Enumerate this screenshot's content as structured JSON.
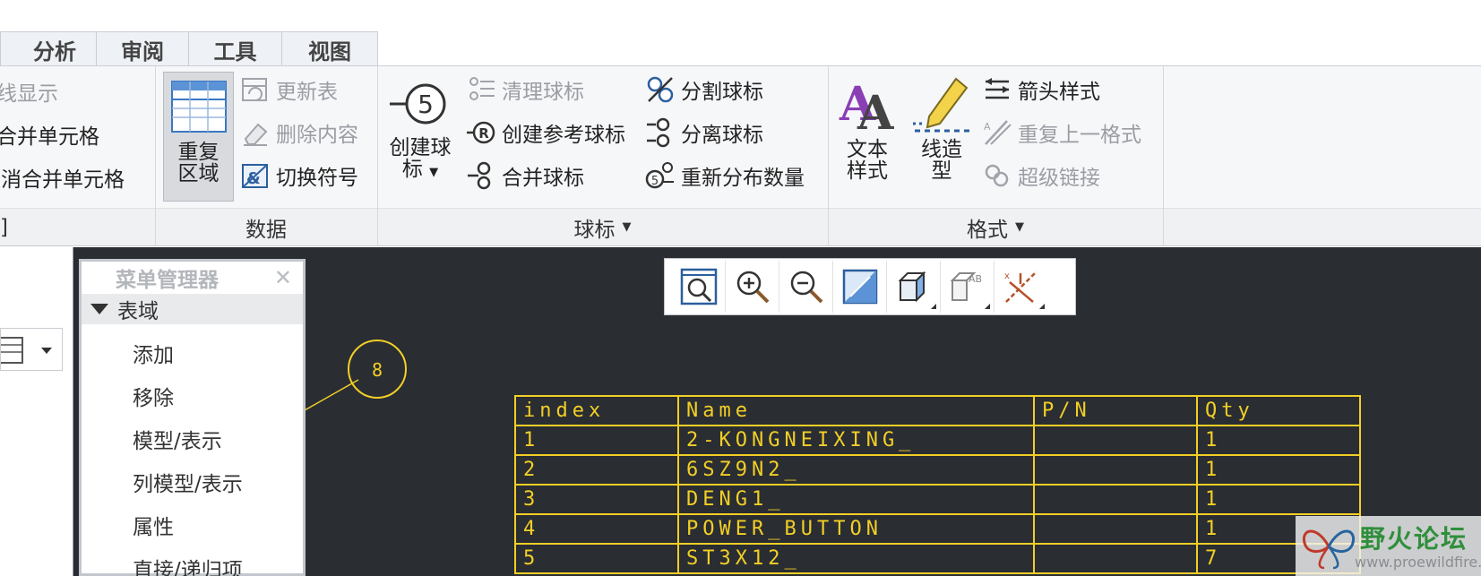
{
  "tabs": [
    "分析",
    "审阅",
    "工具",
    "视图"
  ],
  "ribbon": {
    "col1": [
      "线显示",
      "合并单元格",
      "取消合并单元格"
    ],
    "data_group": {
      "label": "数据",
      "repeat_region": {
        "line1": "重复",
        "line2": "区域"
      },
      "items": [
        "更新表",
        "删除内容",
        "切换符号"
      ]
    },
    "balloon_group": {
      "label": "球标",
      "create": {
        "line1": "创建球",
        "line2": "标"
      },
      "create_icon_text": "5",
      "items_a": [
        "清理球标",
        "创建参考球标",
        "合并球标"
      ],
      "items_b": [
        "分割球标",
        "分离球标",
        "重新分布数量"
      ]
    },
    "format_group": {
      "label": "格式",
      "text_style": {
        "line1": "文本",
        "line2": "样式"
      },
      "line_style": {
        "line1": "线造",
        "line2": "型"
      },
      "items": [
        "箭头样式",
        "重复上一格式",
        "超级链接"
      ]
    },
    "left_partial_label": "]"
  },
  "menu_manager": {
    "title": "菜单管理器",
    "section": "表域",
    "items": [
      "添加",
      "移除",
      "模型/表示",
      "列模型/表示",
      "属性",
      "直接/递归项"
    ]
  },
  "balloon_number": "8",
  "bom": {
    "headers": [
      "index",
      "Name",
      "P/N",
      "Qty"
    ],
    "rows": [
      [
        "1",
        "2-KONGNEIXING_",
        "",
        "1"
      ],
      [
        "2",
        "6SZ9N2_",
        "",
        "1"
      ],
      [
        "3",
        "DENG1_",
        "",
        "1"
      ],
      [
        "4",
        "POWER_BUTTON",
        "",
        "1"
      ],
      [
        "5",
        "ST3X12_",
        "",
        "7"
      ]
    ]
  },
  "watermark": {
    "title": "野火论坛",
    "url": "www.proewildfire.cn"
  },
  "colors": {
    "canvas": "#2a2d32",
    "table_yellow": "#f2cf26",
    "ribbon_bg": "#f6f7f9"
  }
}
